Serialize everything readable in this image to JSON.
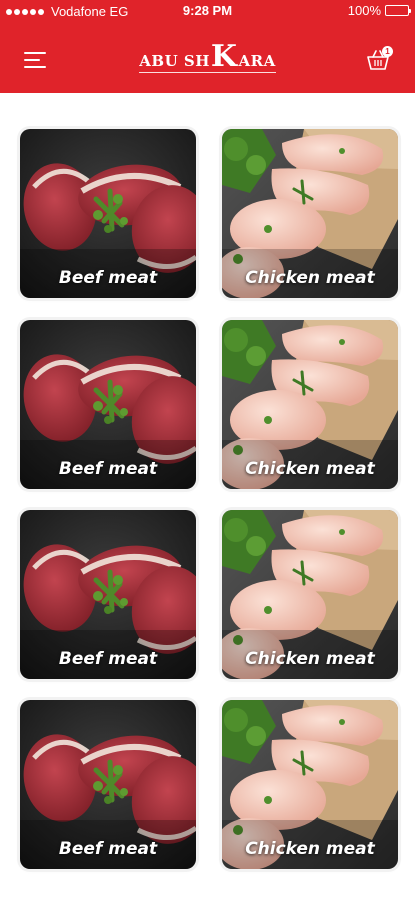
{
  "status_bar": {
    "carrier": "Vodafone EG",
    "time": "9:28 PM",
    "battery": "100%",
    "battery_level": 1.0
  },
  "header": {
    "logo": {
      "part1": "ABU SH",
      "big_letter": "K",
      "part2": "ARA"
    },
    "cart_count": "1",
    "colors": {
      "brand": "#e0232a"
    }
  },
  "categories": [
    {
      "label": "Beef meat",
      "image": "beef"
    },
    {
      "label": "Chicken meat",
      "image": "chicken"
    },
    {
      "label": "Beef meat",
      "image": "beef"
    },
    {
      "label": "Chicken meat",
      "image": "chicken"
    },
    {
      "label": "Beef meat",
      "image": "beef"
    },
    {
      "label": "Chicken meat",
      "image": "chicken"
    },
    {
      "label": "Beef meat",
      "image": "beef"
    },
    {
      "label": "Chicken meat",
      "image": "chicken"
    }
  ],
  "icons": {
    "menu": "hamburger-menu-icon",
    "cart": "shopping-basket-icon"
  }
}
